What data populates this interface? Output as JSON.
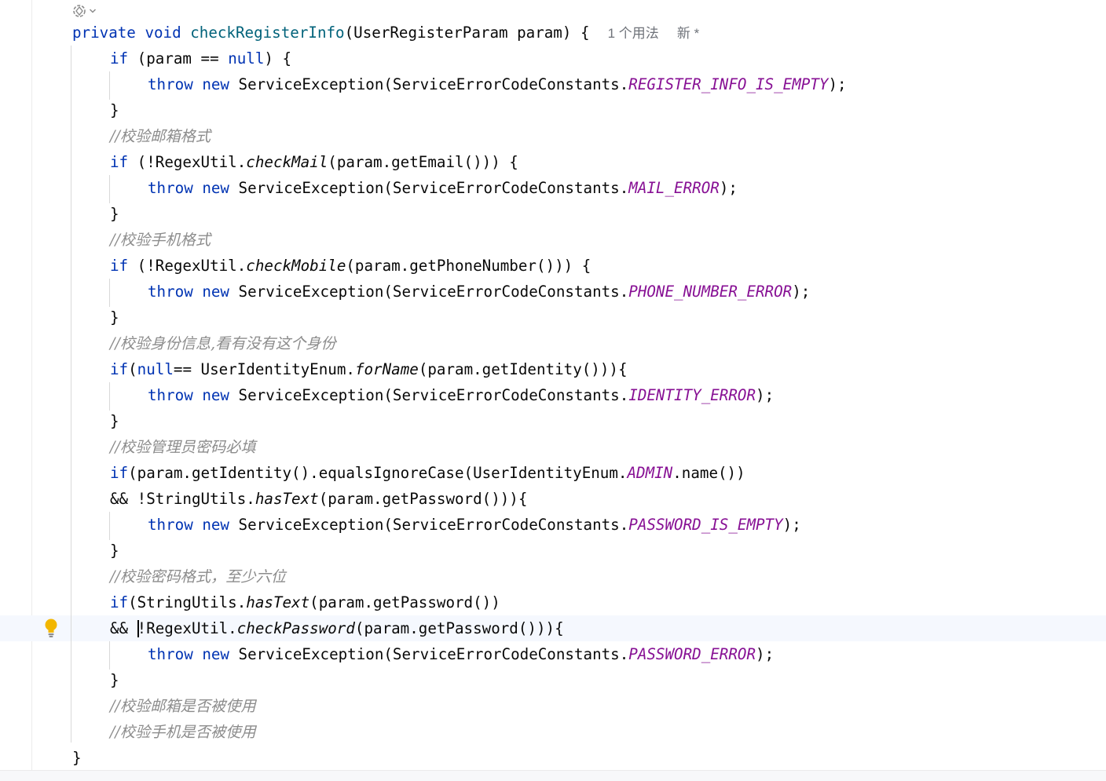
{
  "editor": {
    "inlay_hint": {
      "usages": "1 个用法",
      "author": "新 *"
    },
    "icons": {
      "top": "ai-assistant-icon",
      "gutter": "lightbulb-icon"
    },
    "colors": {
      "keyword": "#0033b3",
      "method_declaration": "#00627a",
      "constant": "#871094",
      "comment": "#8c8c8c",
      "text": "#080808",
      "caret_row": "#f5f8fe",
      "bulb": "#f2b600"
    },
    "code": {
      "signature": {
        "modifier": "private",
        "ret": "void",
        "name": "checkRegisterInfo",
        "params": "(UserRegisterParam param) {"
      },
      "if1": {
        "kw": "if",
        "rest_a": " (param == ",
        "null": "null",
        "rest_b": ") {"
      },
      "comment_mail": "//校验邮箱格式",
      "if2": {
        "kw": "if",
        "head": " (!RegexUtil.",
        "method": "checkMail",
        "tail": "(param.getEmail())) {"
      },
      "comment_mobile": "//校验手机格式",
      "if3": {
        "kw": "if",
        "head": " (!RegexUtil.",
        "method": "checkMobile",
        "tail": "(param.getPhoneNumber())) {"
      },
      "comment_identity": "//校验身份信息,看有没有这个身份",
      "if4": {
        "kw": "if",
        "open": "(",
        "null": "null",
        "mid": "== UserIdentityEnum.",
        "method": "forName",
        "tail": "(param.getIdentity())){"
      },
      "comment_admin_pwd": "//校验管理员密码必填",
      "if5": {
        "kw": "if",
        "head": "(param.getIdentity().equalsIgnoreCase(UserIdentityEnum.",
        "const": "ADMIN",
        "tail": ".name())"
      },
      "cont5": {
        "head": "&& !StringUtils.",
        "method": "hasText",
        "tail": "(param.getPassword())){"
      },
      "comment_pwd_format": "//校验密码格式，至少六位",
      "if6": {
        "kw": "if",
        "head": "(StringUtils.",
        "method": "hasText",
        "tail": "(param.getPassword())"
      },
      "cont6": {
        "amp": "&& ",
        "head": "!RegexUtil.",
        "method": "checkPassword",
        "tail": "(param.getPassword())){"
      },
      "throw": {
        "kw_throw": "throw",
        "kw_new": "new",
        "prefix": "ServiceException(ServiceErrorCodeConstants.",
        "suffix": ");"
      },
      "errors": {
        "register_empty": "REGISTER_INFO_IS_EMPTY",
        "mail": "MAIL_ERROR",
        "phone": "PHONE_NUMBER_ERROR",
        "identity": "IDENTITY_ERROR",
        "password_empty": "PASSWORD_IS_EMPTY",
        "password": "PASSWORD_ERROR"
      },
      "comment_mail_used": "//校验邮箱是否被使用",
      "comment_phone_used": "//校验手机是否被使用",
      "close_brace": "}"
    }
  }
}
